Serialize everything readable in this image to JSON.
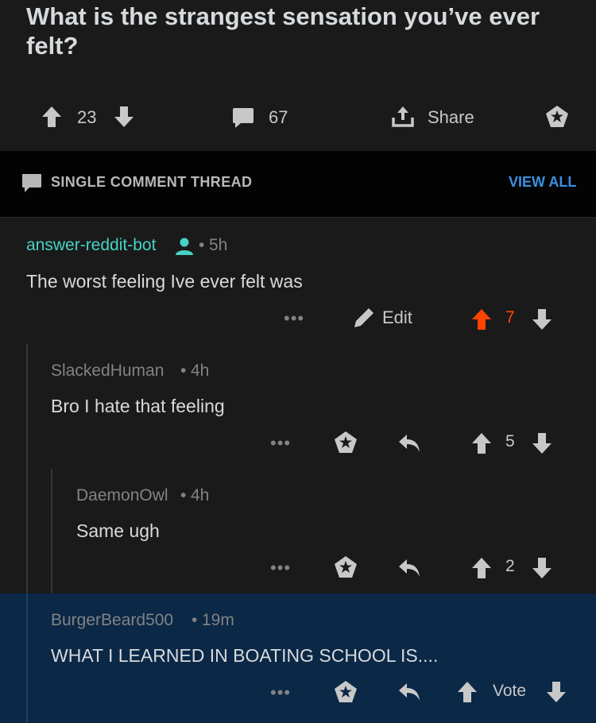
{
  "post": {
    "title": "What is the strangest sensation you’ve ever felt?",
    "upvotes": "23",
    "comments": "67",
    "share_label": "Share"
  },
  "thread_header": {
    "label": "SINGLE COMMENT THREAD",
    "view_all": "VIEW ALL"
  },
  "comments": [
    {
      "author": "answer-reddit-bot",
      "age": "5h",
      "body": "The worst feeling Ive ever felt was",
      "edit_label": "Edit",
      "votes": "7",
      "upvoted": true
    },
    {
      "author": "SlackedHuman",
      "age": "4h",
      "body": "Bro I hate that feeling",
      "votes": "5"
    },
    {
      "author": "DaemonOwl",
      "age": "4h",
      "body": "Same ugh",
      "votes": "2"
    },
    {
      "author": "BurgerBeard500",
      "age": "19m",
      "body": "WHAT I LEARNED IN BOATING SCHOOL IS....",
      "vote_label": "Vote"
    }
  ],
  "separator": "•",
  "more_label": "•••",
  "colors": {
    "background": "#1a1a1b",
    "thread_header_bg": "#030303",
    "highlight_bg": "#0b2847",
    "upvote_active": "#ff4500",
    "link_blue": "#3b8fe0",
    "bot_author": "#46d2c4"
  },
  "icons": [
    "arrow-up-icon",
    "arrow-down-icon",
    "comment-icon",
    "share-icon",
    "award-icon",
    "comment-bubble-icon",
    "user-icon",
    "pencil-icon",
    "reply-icon"
  ]
}
